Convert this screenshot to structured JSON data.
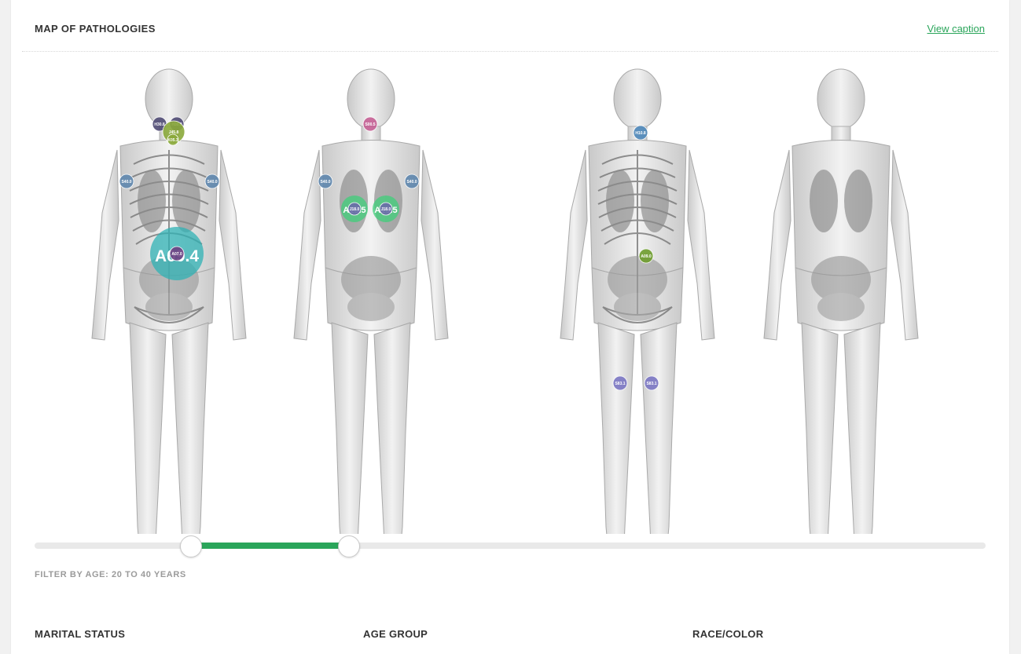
{
  "header": {
    "title": "MAP OF PATHOLOGIES",
    "caption_link": "View caption"
  },
  "figures": [
    {
      "name": "male-front",
      "markers": [
        {
          "code": "H30.8",
          "color": "#4f4a73"
        },
        {
          "code": "H30.8",
          "color": "#4f4a73"
        },
        {
          "code": "J45.8",
          "color": "#8aa83a"
        },
        {
          "code": "K05.3",
          "color": "#8aa83a"
        },
        {
          "code": "S40.0",
          "color": "#5e86ad"
        },
        {
          "code": "S40.0",
          "color": "#5e86ad"
        },
        {
          "code": "A09.4",
          "color": "#2fb2b4"
        },
        {
          "code": "A07.0",
          "color": "#6a3f82"
        }
      ]
    },
    {
      "name": "male-back",
      "markers": [
        {
          "code": "S00.5",
          "color": "#c45f93"
        },
        {
          "code": "S40.0",
          "color": "#5e86ad"
        },
        {
          "code": "S40.0",
          "color": "#5e86ad"
        },
        {
          "code": "A15.5",
          "color": "#3fcf7a"
        },
        {
          "code": "A15.5",
          "color": "#3fcf7a"
        },
        {
          "code": "J18.0",
          "color": "#6a6aa8"
        },
        {
          "code": "J18.0",
          "color": "#6a6aa8"
        }
      ]
    },
    {
      "name": "female-front",
      "markers": [
        {
          "code": "H10.8",
          "color": "#4c86b8"
        },
        {
          "code": "A09.0",
          "color": "#6e9c2e"
        },
        {
          "code": "S83.1",
          "color": "#7a75c2"
        },
        {
          "code": "S83.1",
          "color": "#7a75c2"
        }
      ]
    },
    {
      "name": "female-back",
      "markers": []
    }
  ],
  "slider": {
    "label": "FILTER BY AGE: 20 TO 40 YEARS",
    "min_value": 20,
    "max_value": 40,
    "accent": "#2aa55a"
  },
  "sections": {
    "marital": "MARITAL STATUS",
    "age_group": "AGE GROUP",
    "race": "RACE/COLOR"
  }
}
